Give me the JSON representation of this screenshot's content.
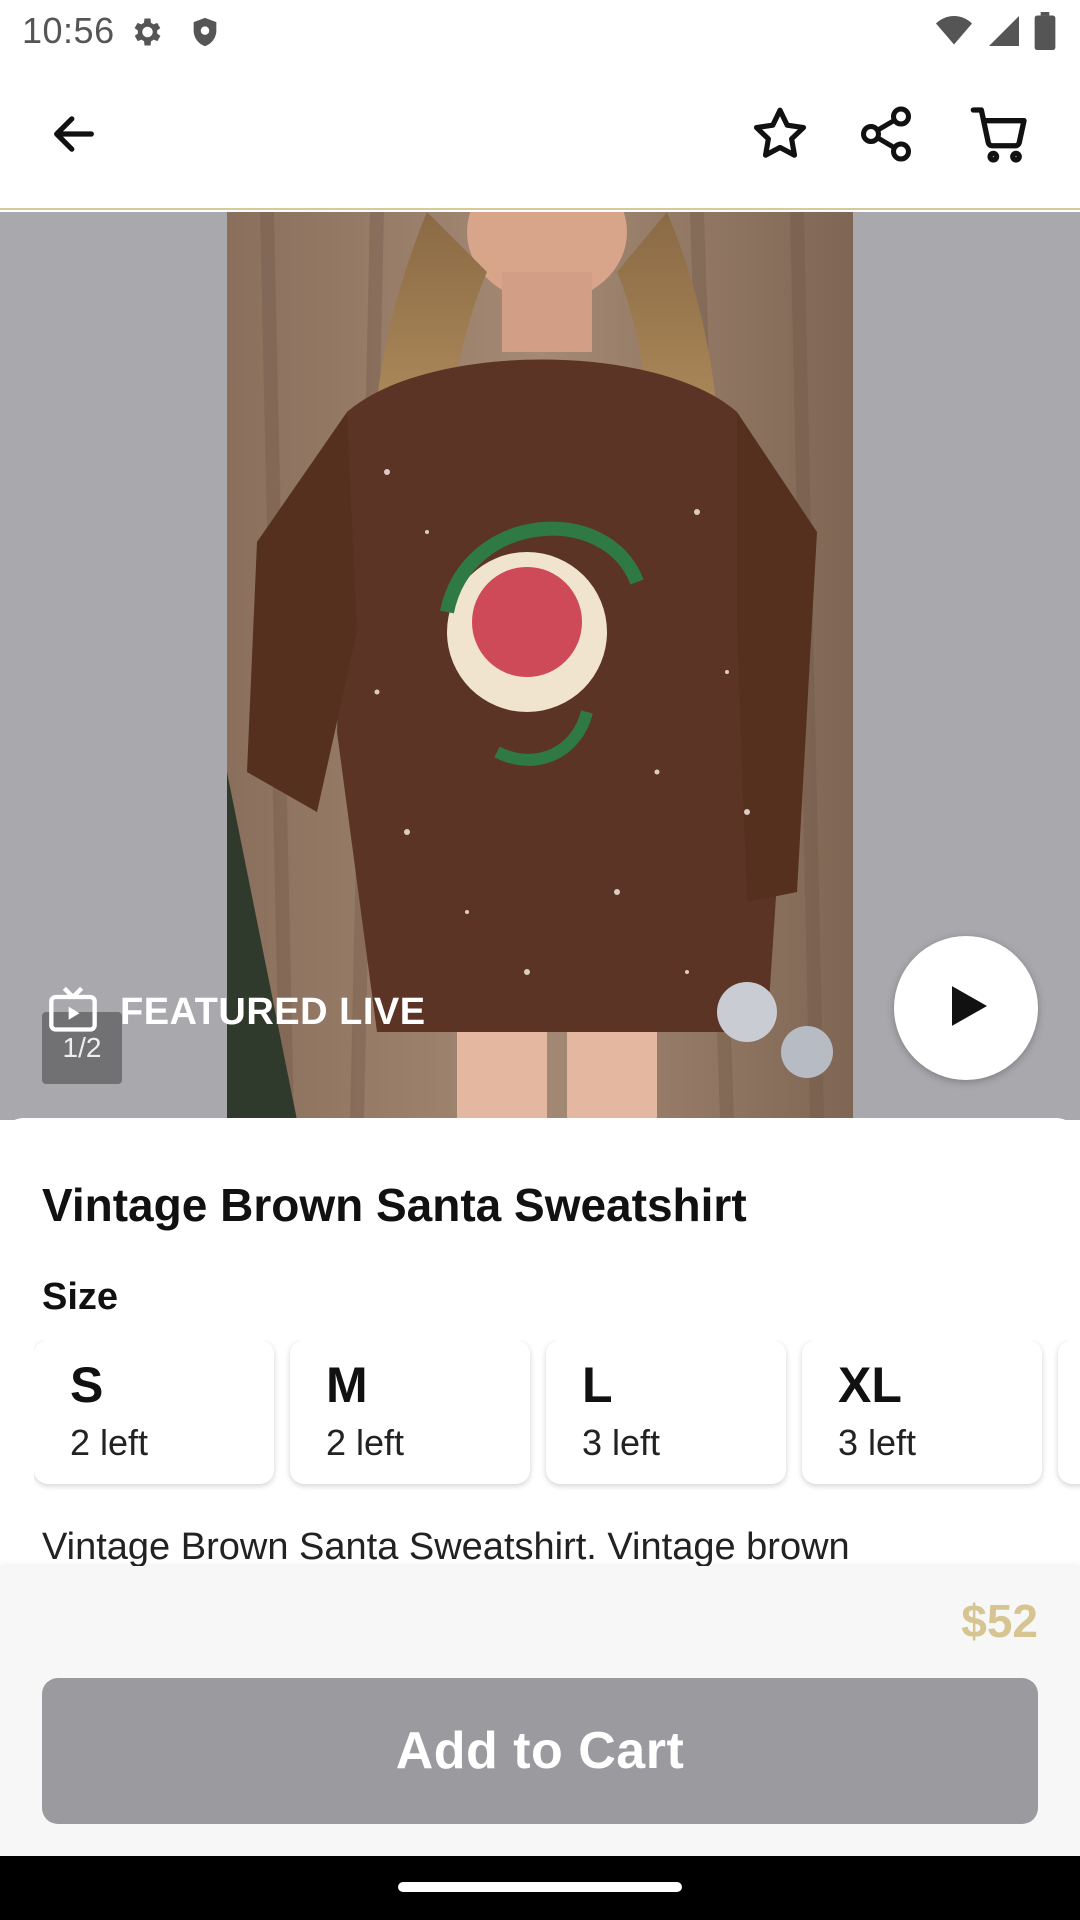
{
  "status": {
    "time": "10:56",
    "icons": [
      "settings-icon",
      "shield-icon",
      "wifi-icon",
      "signal-icon",
      "battery-icon"
    ]
  },
  "header": {
    "back_icon": "arrow-left-icon",
    "actions": [
      "star-icon",
      "share-icon",
      "cart-icon"
    ]
  },
  "gallery": {
    "counter": "1/2",
    "featured_label": "FEATURED LIVE",
    "play_icon": "play-icon"
  },
  "product": {
    "title": "Vintage Brown Santa Sweatshirt",
    "size_label": "Size",
    "sizes": [
      {
        "name": "S",
        "stock": "2 left"
      },
      {
        "name": "M",
        "stock": "2 left"
      },
      {
        "name": "L",
        "stock": "3 left"
      },
      {
        "name": "XL",
        "stock": "3 left"
      }
    ],
    "description": "Vintage Brown Santa Sweatshirt. Vintage brown"
  },
  "footer": {
    "price": "$52",
    "add_to_cart": "Add to Cart"
  },
  "colors": {
    "accent": "#d6c590",
    "button_disabled": "#9b9a9e"
  }
}
